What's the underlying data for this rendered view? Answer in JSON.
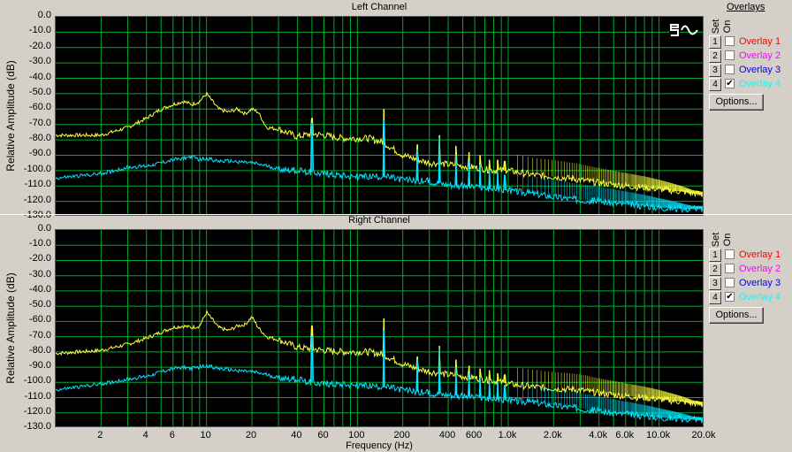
{
  "colors": {
    "grid": "#00aa2a",
    "overlay3": "#00e5ff",
    "overlay4": "#ffff3c"
  },
  "left_panel": {
    "title": "Left Channel",
    "ylabel": "Relative Amplitude (dB)"
  },
  "right_panel": {
    "title": "Right Channel",
    "ylabel": "Relative Amplitude (dB)"
  },
  "yticks": [
    "0.0",
    "-10.0",
    "-20.0",
    "-30.0",
    "-40.0",
    "-50.0",
    "-60.0",
    "-70.0",
    "-80.0",
    "-90.0",
    "-100.0",
    "-110.0",
    "-120.0",
    "-130.0"
  ],
  "xaxis": {
    "label": "Frequency (Hz)",
    "ticks": [
      {
        "label": "2",
        "f": 2
      },
      {
        "label": "4",
        "f": 4
      },
      {
        "label": "6",
        "f": 6
      },
      {
        "label": "10",
        "f": 10
      },
      {
        "label": "20",
        "f": 20
      },
      {
        "label": "40",
        "f": 40
      },
      {
        "label": "60",
        "f": 60
      },
      {
        "label": "100",
        "f": 100
      },
      {
        "label": "200",
        "f": 200
      },
      {
        "label": "400",
        "f": 400
      },
      {
        "label": "600",
        "f": 600
      },
      {
        "label": "1.0k",
        "f": 1000
      },
      {
        "label": "2.0k",
        "f": 2000
      },
      {
        "label": "4.0k",
        "f": 4000
      },
      {
        "label": "6.0k",
        "f": 6000
      },
      {
        "label": "10.0k",
        "f": 10000
      },
      {
        "label": "20.0k",
        "f": 20000
      }
    ]
  },
  "overlays_panel": {
    "title": "Overlays",
    "set_label": "Set",
    "on_label": "On",
    "options_label": "Options...",
    "rows": [
      {
        "set": "1",
        "label": "Overlay 1",
        "color": "#ff0000",
        "checked": false
      },
      {
        "set": "2",
        "label": "Overlay 2",
        "color": "#ff00ff",
        "checked": false
      },
      {
        "set": "3",
        "label": "Overlay 3",
        "color": "#0000ff",
        "checked": false
      },
      {
        "set": "4",
        "label": "Overlay 4",
        "color": "#00ffff",
        "checked": true
      }
    ]
  },
  "chart_data": [
    {
      "type": "line",
      "title": "Left Channel",
      "xlabel": "Frequency (Hz)",
      "ylabel": "Relative Amplitude (dB)",
      "xscale": "log",
      "xlim": [
        1,
        20000
      ],
      "ylim": [
        -130,
        0
      ],
      "grid": true,
      "series": [
        {
          "name": "Overlay 4",
          "color": "#ffff3c",
          "x": [
            1,
            2,
            3,
            4,
            5,
            6,
            7,
            8,
            9,
            10,
            12,
            14,
            16,
            18,
            20,
            22,
            25,
            30,
            40,
            50,
            60,
            80,
            100,
            120,
            150,
            200,
            250,
            300,
            400,
            500,
            600,
            800,
            1000,
            1500,
            2000,
            3000,
            4000,
            6000,
            8000,
            10000,
            15000,
            20000
          ],
          "y": [
            -77,
            -77,
            -72,
            -66,
            -60,
            -57,
            -55,
            -57,
            -55,
            -50,
            -60,
            -62,
            -60,
            -63,
            -60,
            -62,
            -72,
            -73,
            -78,
            -76,
            -77,
            -79,
            -79,
            -79,
            -82,
            -90,
            -93,
            -95,
            -96,
            -97,
            -98,
            -100,
            -100,
            -103,
            -104,
            -106,
            -108,
            -110,
            -111,
            -112,
            -114,
            -116
          ],
          "peaks": [
            {
              "x": 50,
              "y": -66
            },
            {
              "x": 150,
              "y": -60
            },
            {
              "x": 250,
              "y": -83
            },
            {
              "x": 350,
              "y": -77
            },
            {
              "x": 450,
              "y": -84
            },
            {
              "x": 550,
              "y": -88
            },
            {
              "x": 650,
              "y": -90
            },
            {
              "x": 750,
              "y": -93
            },
            {
              "x": 850,
              "y": -93
            },
            {
              "x": 950,
              "y": -94
            }
          ]
        },
        {
          "name": "Overlay 3",
          "color": "#00e5ff",
          "x": [
            1,
            2,
            3,
            4,
            5,
            6,
            7,
            8,
            9,
            10,
            12,
            15,
            20,
            25,
            30,
            40,
            50,
            60,
            80,
            100,
            150,
            200,
            300,
            400,
            500,
            600,
            800,
            1000,
            1500,
            2000,
            3000,
            4000,
            6000,
            8000,
            10000,
            15000,
            20000
          ],
          "y": [
            -105,
            -102,
            -98,
            -97,
            -95,
            -93,
            -92,
            -91,
            -93,
            -92,
            -94,
            -94,
            -95,
            -97,
            -99,
            -100,
            -101,
            -102,
            -103,
            -104,
            -104,
            -106,
            -107,
            -109,
            -110,
            -111,
            -112,
            -113,
            -115,
            -117,
            -119,
            -120,
            -122,
            -123,
            -124,
            -125,
            -125
          ],
          "peaks": [
            {
              "x": 50,
              "y": -69
            },
            {
              "x": 150,
              "y": -67
            },
            {
              "x": 250,
              "y": -86
            },
            {
              "x": 350,
              "y": -79
            },
            {
              "x": 450,
              "y": -90
            },
            {
              "x": 550,
              "y": -94
            },
            {
              "x": 650,
              "y": -96
            },
            {
              "x": 750,
              "y": -99
            },
            {
              "x": 850,
              "y": -101
            },
            {
              "x": 950,
              "y": -103
            }
          ]
        }
      ]
    },
    {
      "type": "line",
      "title": "Right Channel",
      "xlabel": "Frequency (Hz)",
      "ylabel": "Relative Amplitude (dB)",
      "xscale": "log",
      "xlim": [
        1,
        20000
      ],
      "ylim": [
        -130,
        0
      ],
      "grid": true,
      "series": [
        {
          "name": "Overlay 4",
          "color": "#ffff3c",
          "x": [
            1,
            2,
            3,
            4,
            5,
            6,
            7,
            8,
            9,
            10,
            12,
            14,
            16,
            18,
            20,
            22,
            25,
            30,
            40,
            50,
            60,
            80,
            100,
            120,
            150,
            200,
            250,
            300,
            400,
            500,
            600,
            800,
            1000,
            1500,
            2000,
            3000,
            4000,
            6000,
            8000,
            10000,
            15000,
            20000
          ],
          "y": [
            -81,
            -79,
            -75,
            -71,
            -67,
            -64,
            -63,
            -64,
            -63,
            -54,
            -64,
            -66,
            -63,
            -62,
            -57,
            -64,
            -70,
            -72,
            -77,
            -78,
            -79,
            -80,
            -80,
            -80,
            -82,
            -88,
            -91,
            -93,
            -95,
            -96,
            -97,
            -99,
            -101,
            -103,
            -104,
            -105,
            -107,
            -109,
            -110,
            -111,
            -113,
            -115
          ],
          "peaks": [
            {
              "x": 50,
              "y": -63
            },
            {
              "x": 150,
              "y": -58
            },
            {
              "x": 250,
              "y": -83
            },
            {
              "x": 350,
              "y": -76
            },
            {
              "x": 450,
              "y": -85
            },
            {
              "x": 550,
              "y": -89
            },
            {
              "x": 650,
              "y": -91
            },
            {
              "x": 750,
              "y": -92
            },
            {
              "x": 850,
              "y": -94
            },
            {
              "x": 950,
              "y": -95
            }
          ]
        },
        {
          "name": "Overlay 3",
          "color": "#00e5ff",
          "x": [
            1,
            2,
            3,
            4,
            5,
            6,
            7,
            8,
            9,
            10,
            12,
            15,
            20,
            25,
            30,
            40,
            50,
            60,
            80,
            100,
            150,
            200,
            300,
            400,
            500,
            600,
            800,
            1000,
            1500,
            2000,
            3000,
            4000,
            6000,
            8000,
            10000,
            15000,
            20000
          ],
          "y": [
            -105,
            -101,
            -98,
            -96,
            -93,
            -91,
            -90,
            -91,
            -90,
            -89,
            -91,
            -92,
            -93,
            -95,
            -97,
            -98,
            -100,
            -101,
            -101,
            -102,
            -103,
            -105,
            -107,
            -108,
            -109,
            -110,
            -111,
            -112,
            -113,
            -115,
            -117,
            -119,
            -121,
            -122,
            -123,
            -124,
            -125
          ],
          "peaks": [
            {
              "x": 50,
              "y": -70
            },
            {
              "x": 150,
              "y": -66
            },
            {
              "x": 250,
              "y": -85
            },
            {
              "x": 350,
              "y": -78
            },
            {
              "x": 450,
              "y": -90
            },
            {
              "x": 550,
              "y": -94
            },
            {
              "x": 650,
              "y": -96
            },
            {
              "x": 750,
              "y": -98
            },
            {
              "x": 850,
              "y": -100
            },
            {
              "x": 950,
              "y": -102
            }
          ]
        }
      ]
    }
  ]
}
